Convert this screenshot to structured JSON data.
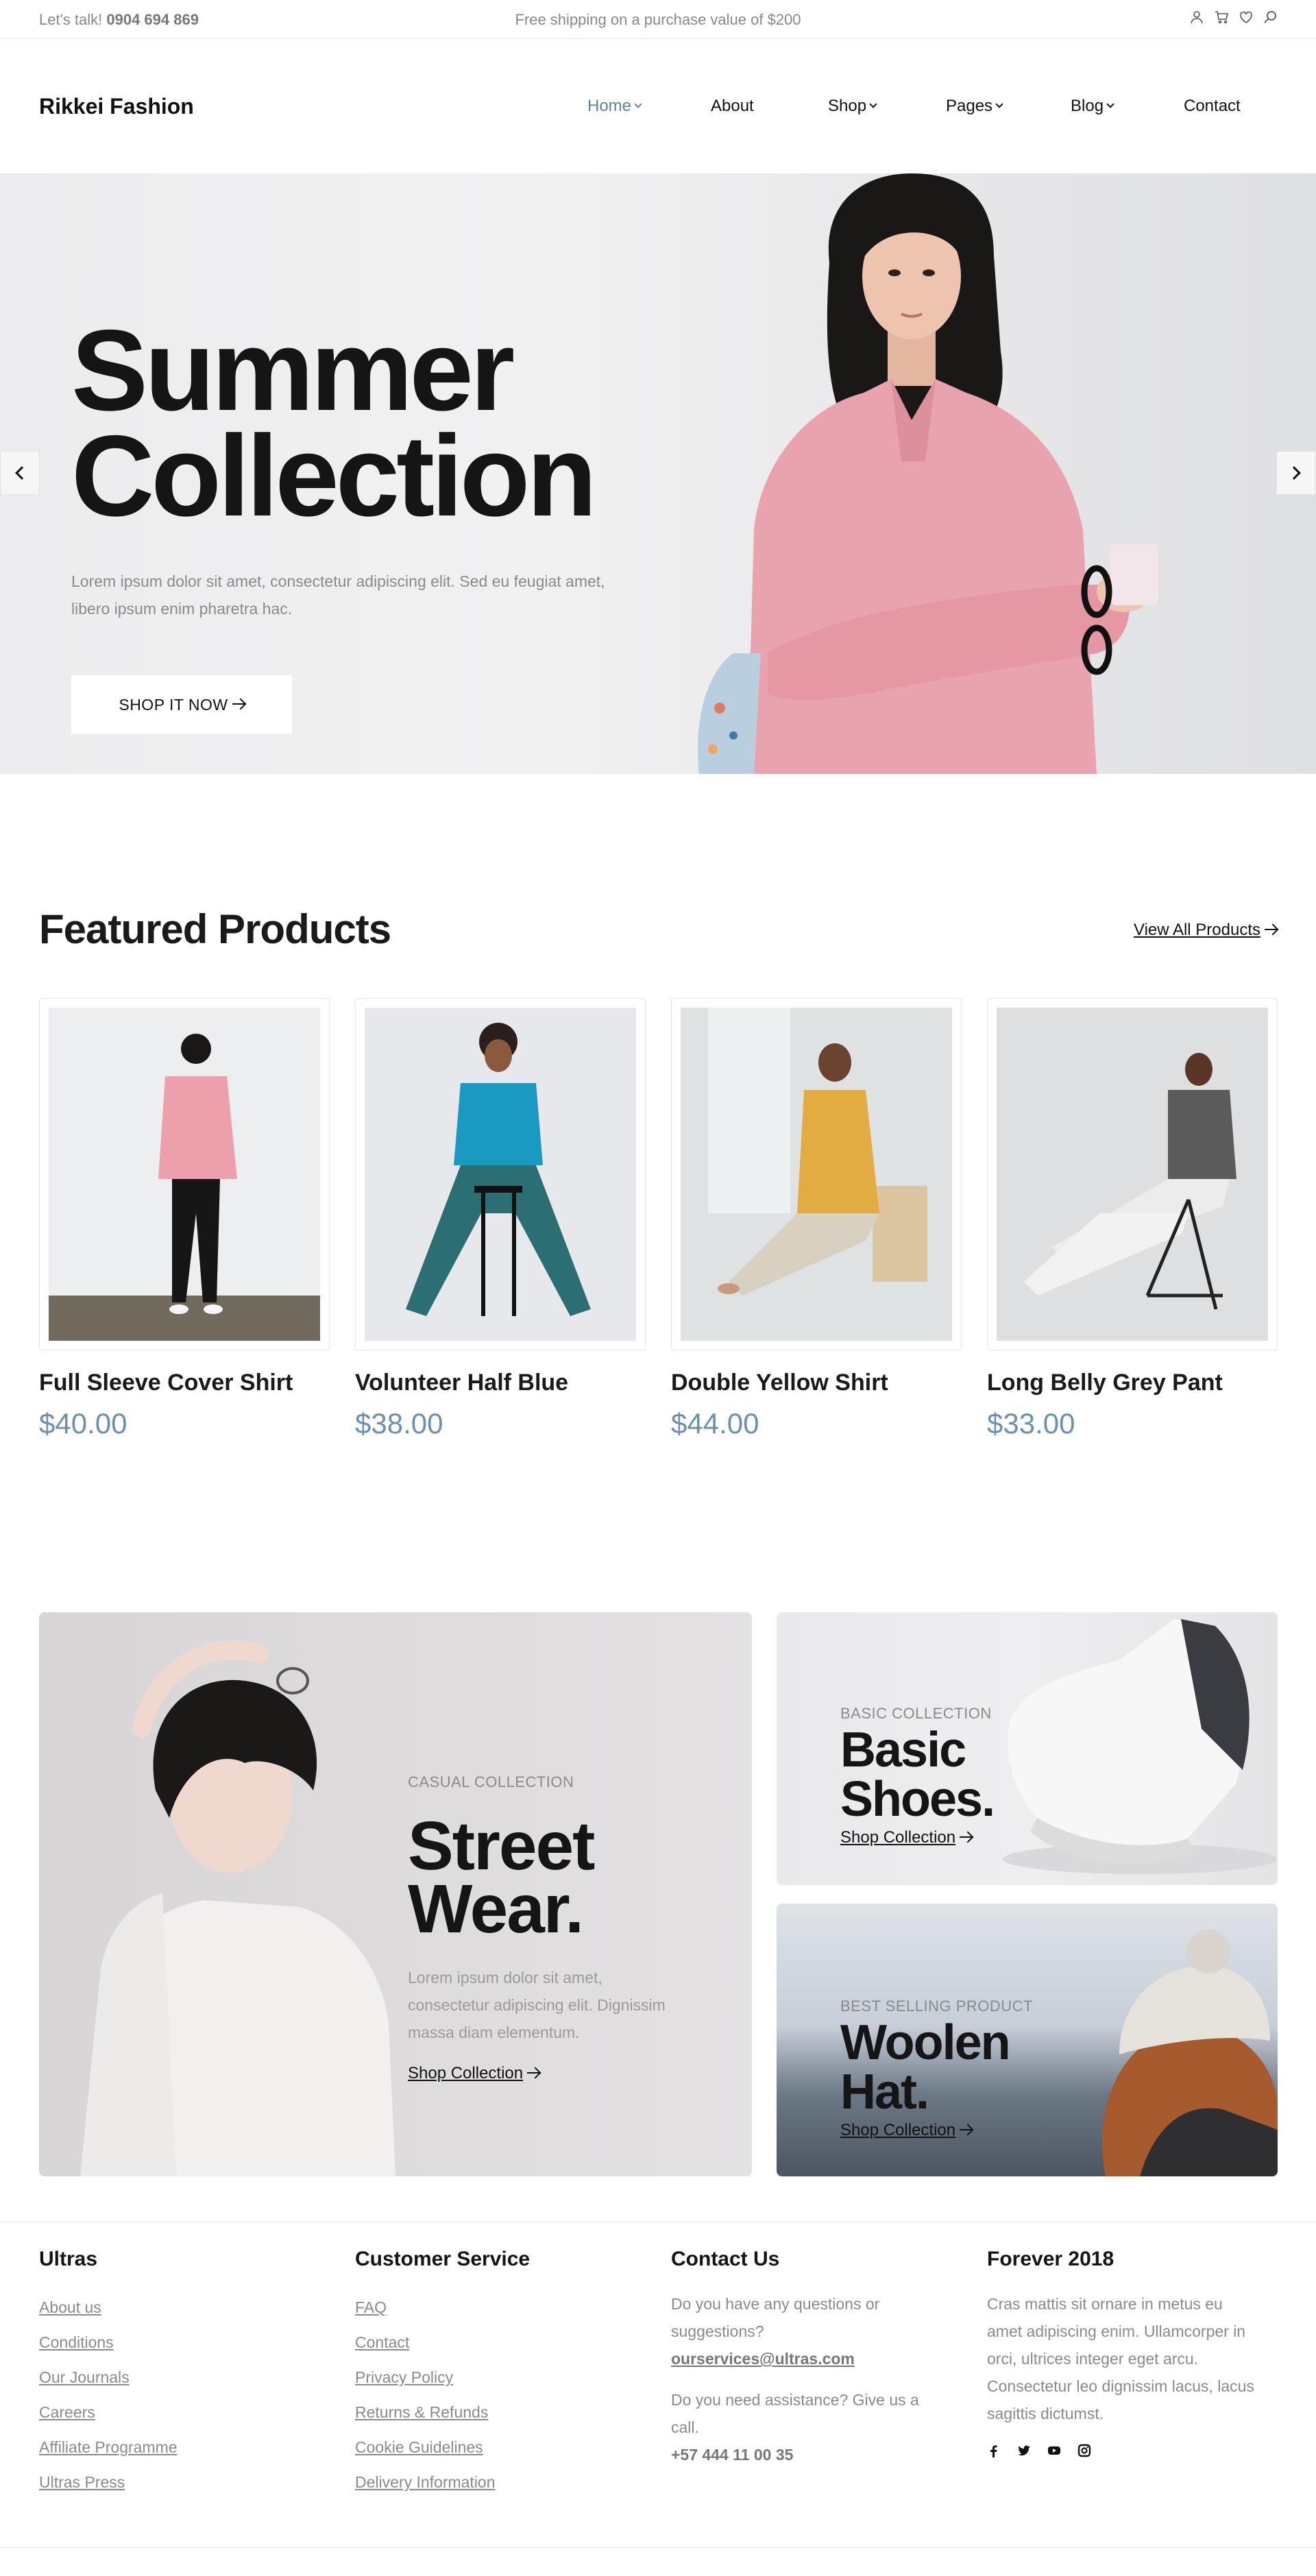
{
  "topbar": {
    "talk_label": "Let's talk!",
    "phone": "0904 694 869",
    "shipping": "Free shipping on a purchase value of $200",
    "icons": [
      "user-icon",
      "cart-icon",
      "heart-icon",
      "search-icon"
    ]
  },
  "header": {
    "logo": "Rikkei Fashion",
    "nav": [
      {
        "label": "Home",
        "dropdown": true,
        "active": true
      },
      {
        "label": "About",
        "dropdown": false
      },
      {
        "label": "Shop",
        "dropdown": true
      },
      {
        "label": "Pages",
        "dropdown": true
      },
      {
        "label": "Blog",
        "dropdown": true
      },
      {
        "label": "Contact",
        "dropdown": false
      }
    ]
  },
  "hero": {
    "title_line1": "Summer",
    "title_line2": "Collection",
    "description": "Lorem ipsum dolor sit amet, consectetur adipiscing elit. Sed eu feugiat amet, libero ipsum enim pharetra hac.",
    "button": "SHOP IT NOW"
  },
  "featured": {
    "title": "Featured Products",
    "view_all": "View All Products",
    "products": [
      {
        "name": "Full Sleeve Cover Shirt",
        "price": "$40.00"
      },
      {
        "name": "Volunteer Half Blue",
        "price": "$38.00"
      },
      {
        "name": "Double Yellow Shirt",
        "price": "$44.00"
      },
      {
        "name": "Long Belly Grey Pant",
        "price": "$33.00"
      }
    ]
  },
  "promos": {
    "street": {
      "subtitle": "CASUAL COLLECTION",
      "title_line1": "Street",
      "title_line2": "Wear.",
      "description": "Lorem ipsum dolor sit amet, consectetur adipiscing elit. Dignissim massa diam elementum.",
      "link": "Shop Collection"
    },
    "shoes": {
      "subtitle": "BASIC COLLECTION",
      "title_line1": "Basic",
      "title_line2": "Shoes.",
      "link": "Shop Collection"
    },
    "hat": {
      "subtitle": "BEST SELLING PRODUCT",
      "title_line1": "Woolen",
      "title_line2": "Hat.",
      "link": "Shop Collection"
    }
  },
  "footer": {
    "col1": {
      "title": "Ultras",
      "links": [
        "About us",
        "Conditions",
        "Our Journals",
        "Careers",
        "Affiliate Programme",
        "Ultras Press"
      ]
    },
    "col2": {
      "title": "Customer Service",
      "links": [
        "FAQ",
        "Contact",
        "Privacy Policy",
        "Returns & Refunds",
        "Cookie Guidelines",
        "Delivery Information"
      ]
    },
    "col3": {
      "title": "Contact Us",
      "question": "Do you have any questions or suggestions?",
      "email": "ourservices@ultras.com",
      "assist": "Do you need assistance? Give us a call.",
      "phone": "+57 444 11 00 35"
    },
    "col4": {
      "title": "Forever 2018",
      "text": "Cras mattis sit ornare in metus eu amet adipiscing enim. Ullamcorper in orci, ultrices integer eget arcu. Consectetur leo dignissim lacus, lacus sagittis dictumst.",
      "social": [
        "facebook-icon",
        "twitter-icon",
        "youtube-icon",
        "instagram-icon"
      ]
    }
  },
  "colors": {
    "accent": "#5b84a8",
    "price": "#6a91b0",
    "text": "#1a1a1a",
    "muted": "#8a8a8a"
  }
}
